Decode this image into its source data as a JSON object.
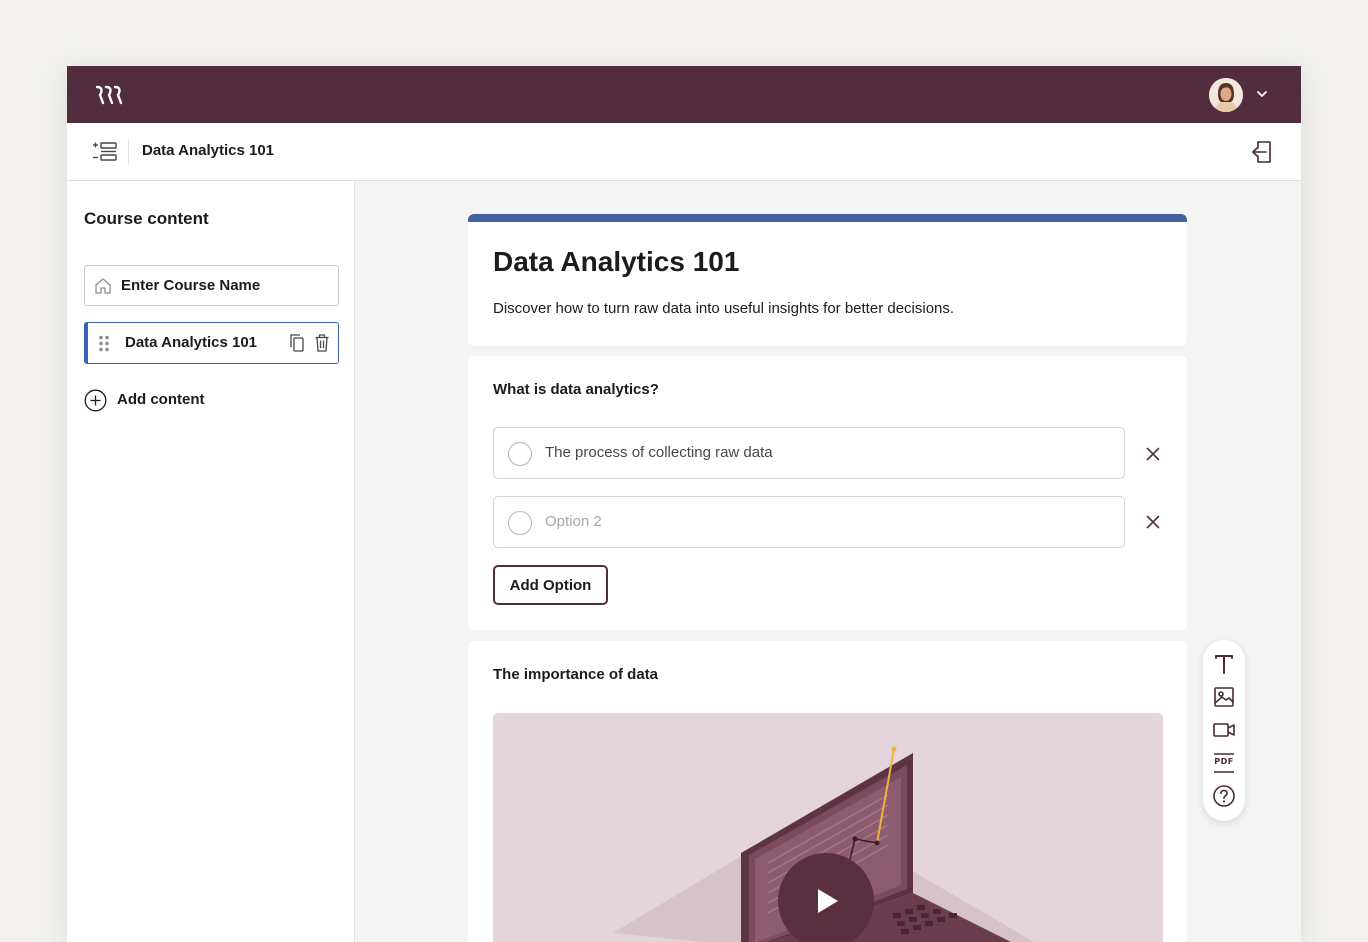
{
  "header": {
    "brand_logo": "rrr-logo",
    "avatar_icon": "user-avatar",
    "menu_icon": "chevron-down-icon"
  },
  "subbar": {
    "title": "Data Analytics 101",
    "outline_icon": "outline-list-icon",
    "exit_icon": "exit-icon"
  },
  "sidebar": {
    "heading": "Course content",
    "course_name_field": "Enter Course Name",
    "items": [
      {
        "label": "Data Analytics 101"
      }
    ],
    "add_content_label": "Add content"
  },
  "main": {
    "header_card": {
      "title": "Data Analytics 101",
      "description": "Discover how to turn raw data into useful insights for better decisions."
    },
    "quiz": {
      "question": "What is data analytics?",
      "options": [
        {
          "value": "The process of collecting raw data",
          "placeholder": ""
        },
        {
          "value": "",
          "placeholder": "Option 2"
        }
      ],
      "add_option_label": "Add Option"
    },
    "media_block": {
      "title": "The importance of data",
      "video_icon": "play-icon"
    }
  },
  "toolbox": {
    "tools": [
      "text-icon",
      "image-icon",
      "video-icon",
      "pdf-icon",
      "question-icon"
    ],
    "pdf_label": "PDF"
  },
  "colors": {
    "topbar": "#522d3e",
    "accent": "#4661a3",
    "selection": "#3a64b0",
    "video_bg": "#e4d5da"
  }
}
